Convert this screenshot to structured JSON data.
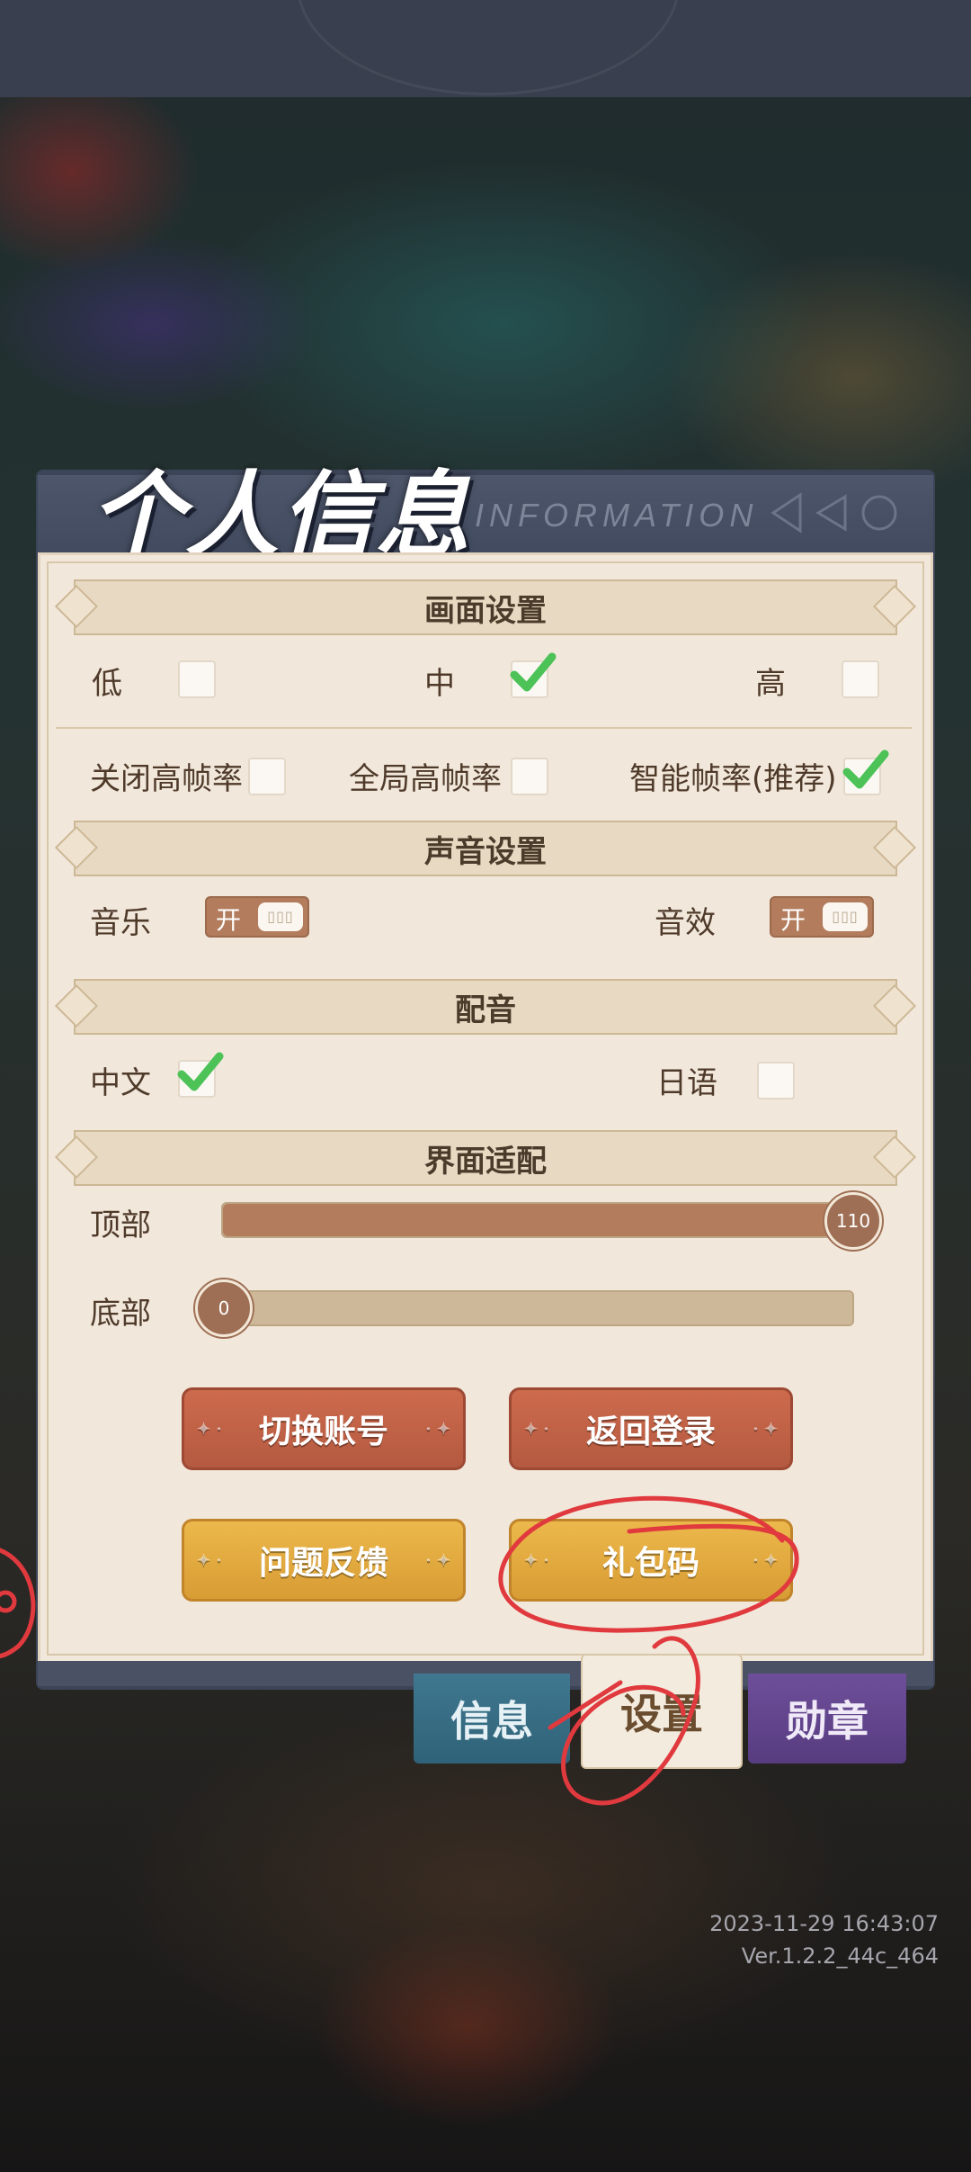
{
  "header": {
    "title": "个人信息",
    "subtitle": "INFORMATION"
  },
  "graphics": {
    "section_title": "画面设置",
    "quality_options": [
      {
        "label": "低",
        "checked": false
      },
      {
        "label": "中",
        "checked": true
      },
      {
        "label": "高",
        "checked": false
      }
    ],
    "framerate_options": [
      {
        "label": "关闭高帧率",
        "checked": false
      },
      {
        "label": "全局高帧率",
        "checked": false
      },
      {
        "label": "智能帧率(推荐)",
        "checked": true
      }
    ]
  },
  "sound": {
    "section_title": "声音设置",
    "music": {
      "label": "音乐",
      "state": "开",
      "on": true
    },
    "sfx": {
      "label": "音效",
      "state": "开",
      "on": true
    }
  },
  "voice": {
    "section_title": "配音",
    "options": [
      {
        "label": "中文",
        "checked": true
      },
      {
        "label": "日语",
        "checked": false
      }
    ]
  },
  "ui_adapt": {
    "section_title": "界面适配",
    "top": {
      "label": "顶部",
      "value": "110",
      "max": 110
    },
    "bottom": {
      "label": "底部",
      "value": "0",
      "max": 110
    }
  },
  "buttons": {
    "switch_account": "切换账号",
    "return_login": "返回登录",
    "feedback": "问题反馈",
    "gift_code": "礼包码"
  },
  "tabs": [
    {
      "label": "信息",
      "active": false
    },
    {
      "label": "设置",
      "active": true
    },
    {
      "label": "勋章",
      "active": false
    }
  ],
  "meta": {
    "timestamp": "2023-11-29 16:43:07",
    "version": "Ver.1.2.2_44c_464"
  },
  "colors": {
    "accent_red": "#c2614a",
    "accent_gold": "#e4ac40",
    "panel": "#f1e8db",
    "check_green": "#4cc257",
    "annotation": "#e0393e"
  }
}
